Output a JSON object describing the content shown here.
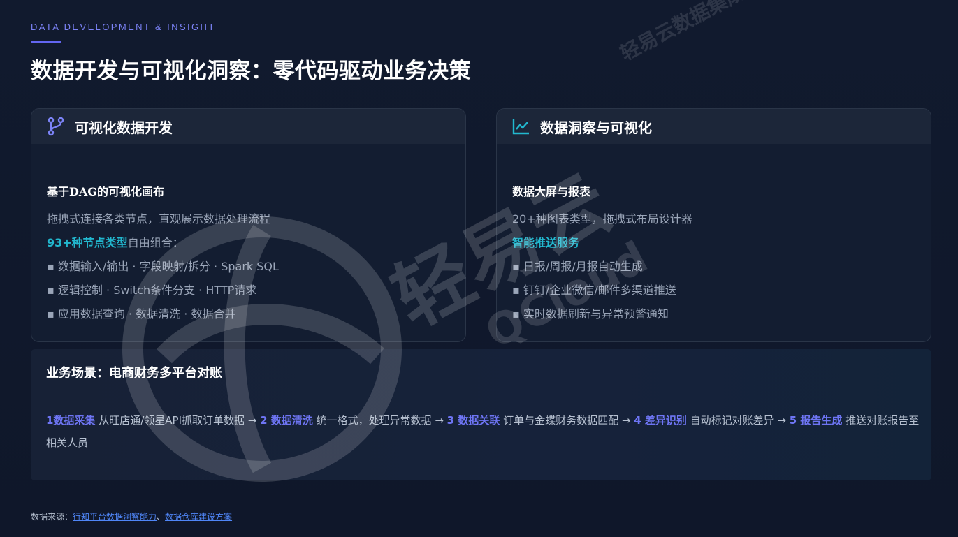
{
  "header": {
    "eyebrow": "DATA DEVELOPMENT & INSIGHT",
    "title": "数据开发与可视化洞察：零代码驱动业务决策"
  },
  "cards": [
    {
      "icon": "git-branch-icon",
      "title": "可视化数据开发",
      "subtitle": "基于DAG的可视化画布",
      "desc": "拖拽式连接各类节点，直观展示数据处理流程",
      "highlight": "93+种节点类型",
      "highlight_suffix": "自由组合：",
      "bullets": [
        "▪ 数据输入/输出 · 字段映射/拆分 · Spark SQL",
        "▪ 逻辑控制 · Switch条件分支 · HTTP请求",
        "▪ 应用数据查询 · 数据清洗 · 数据合并"
      ]
    },
    {
      "icon": "line-chart-icon",
      "title": "数据洞察与可视化",
      "subtitle": "数据大屏与报表",
      "desc": "20+种图表类型，拖拽式布局设计器",
      "highlight": "智能推送服务",
      "bullets": [
        "▪ 日报/周报/月报自动生成",
        "▪ 钉钉/企业微信/邮件多渠道推送",
        "▪ 实时数据刷新与异常预警通知"
      ]
    }
  ],
  "scenario": {
    "title": "业务场景：电商财务多平台对账",
    "steps": [
      {
        "label": "1数据采集",
        "text": " 从旺店通/领星API抓取订单数据 → "
      },
      {
        "label": "2 数据清洗",
        "text": " 统一格式，处理异常数据 → "
      },
      {
        "label": "3 数据关联",
        "text": " 订单与金蝶财务数据匹配 → "
      },
      {
        "label": "4 差异识别",
        "text": " 自动标记对账差异 → "
      },
      {
        "label": "5 报告生成",
        "text": " 推送对账报告至相关人员"
      }
    ]
  },
  "footer": {
    "prefix": "数据来源：",
    "link1": "行知平台数据洞察能力",
    "separator": "、",
    "link2": "数据仓库建设方案"
  },
  "watermark": {
    "text": "轻易云数据集成平台",
    "logo_text": "轻易云",
    "logo_sub": "QCloud"
  },
  "colors": {
    "accent": "#6366f1",
    "highlight": "#22b8cf",
    "step": "#6e75f4",
    "link": "#4f86f7"
  }
}
